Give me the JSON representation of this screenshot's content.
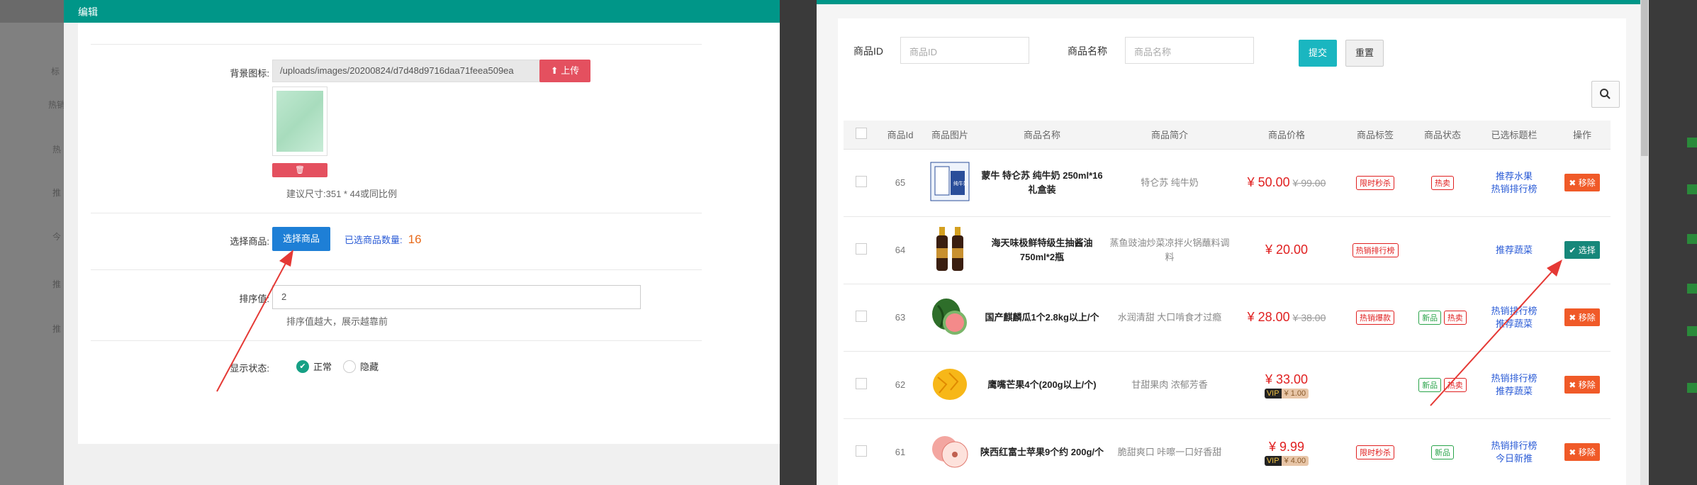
{
  "left_modal": {
    "title": "编辑",
    "bg_icon_label": "背景图标:",
    "bg_path": "/uploads/images/20200824/d7d48d9716daa71feea509ea",
    "upload_label": "上传",
    "delete_icon": "trash-icon",
    "size_hint": "建议尺寸:351 * 44或同比例",
    "select_label": "选择商品:",
    "select_button": "选择商品",
    "selected_count_label": "已选商品数量:",
    "selected_count": "16",
    "sort_label": "排序值:",
    "sort_value": "2",
    "sort_hint": "排序值越大，展示越靠前",
    "status_label": "显示状态:",
    "status_on": "正常",
    "status_off": "隐藏"
  },
  "background_left": {
    "items": [
      "标",
      "热销",
      "热",
      "推",
      "今",
      "推",
      "推"
    ]
  },
  "right_modal": {
    "filters": {
      "id_label": "商品ID",
      "id_placeholder": "商品ID",
      "name_label": "商品名称",
      "name_placeholder": "商品名称",
      "submit": "提交",
      "reset": "重置"
    },
    "table": {
      "headers": [
        "商品Id",
        "商品图片",
        "商品名称",
        "商品简介",
        "商品价格",
        "商品标签",
        "商品状态",
        "已选标题栏",
        "操作"
      ],
      "rows": [
        {
          "id": "65",
          "name": "蒙牛 特仑苏 纯牛奶 250ml*16 礼盒装",
          "desc": "特仑苏 纯牛奶",
          "price": "¥ 50.00",
          "old_price": "¥ 99.00",
          "vip": "",
          "tag": "限时秒杀",
          "status": [
            "热卖"
          ],
          "sections": [
            "推荐水果",
            "热销排行榜"
          ],
          "action": "移除",
          "action_type": "remove",
          "img": "milk"
        },
        {
          "id": "64",
          "name": "海天味极鲜特级生抽酱油 750ml*2瓶",
          "desc": "蒸鱼豉油炒菜凉拌火锅蘸料调料",
          "price": "¥ 20.00",
          "old_price": "",
          "vip": "",
          "tag": "热销排行榜",
          "status": [],
          "sections": [
            "推荐蔬菜"
          ],
          "action": "选择",
          "action_type": "select",
          "img": "soy"
        },
        {
          "id": "63",
          "name": "国产麒麟瓜1个2.8kg以上/个",
          "desc": "水润清甜 大口啃食才过瘾",
          "price": "¥ 28.00",
          "old_price": "¥ 38.00",
          "vip": "",
          "tag": "热销爆款",
          "status": [
            "新品",
            "热卖"
          ],
          "sections": [
            "热销排行榜",
            "推荐蔬菜"
          ],
          "action": "移除",
          "action_type": "remove",
          "img": "melon"
        },
        {
          "id": "62",
          "name": "鹰嘴芒果4个(200g以上/个)",
          "desc": "甘甜果肉 浓郁芳香",
          "price": "¥ 33.00",
          "old_price": "",
          "vip": "¥ 1.00",
          "tag": "",
          "status": [
            "新品",
            "热卖"
          ],
          "sections": [
            "热销排行榜",
            "推荐蔬菜"
          ],
          "action": "移除",
          "action_type": "remove",
          "img": "mango"
        },
        {
          "id": "61",
          "name": "陕西红富士苹果9个约 200g/个",
          "desc": "脆甜爽口 咔嚓一口好香甜",
          "price": "¥ 9.99",
          "old_price": "",
          "vip": "¥ 4.00",
          "tag": "限时秒杀",
          "status": [
            "新品"
          ],
          "sections": [
            "热销排行榜",
            "今日新推"
          ],
          "action": "移除",
          "action_type": "remove",
          "img": "apple"
        }
      ]
    }
  },
  "colors": {
    "accent": "#009688",
    "danger": "#e4505f",
    "primary": "#1e7fd6",
    "price": "#e02020"
  }
}
